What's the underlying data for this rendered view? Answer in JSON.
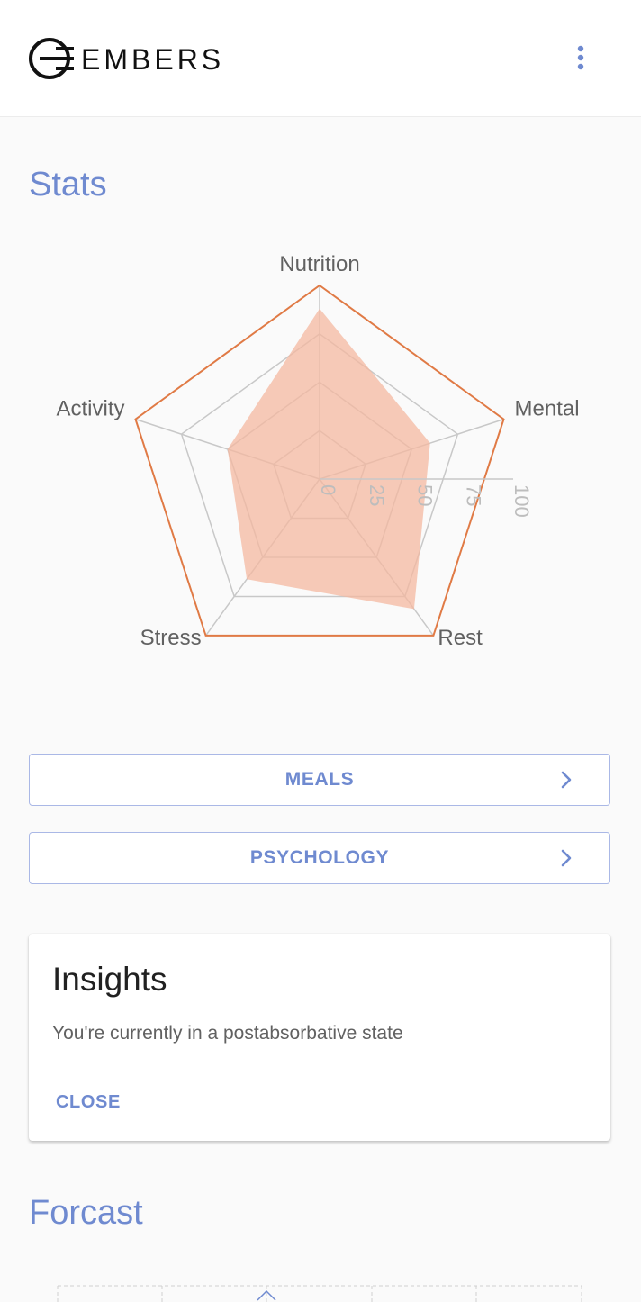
{
  "header": {
    "brand": "EMBERS",
    "menu_icon": "more-vert-icon"
  },
  "stats": {
    "title": "Stats",
    "chart_data": {
      "type": "radar",
      "axes": [
        "Nutrition",
        "Mental",
        "Rest",
        "Stress",
        "Activity"
      ],
      "ticks": [
        "0",
        "25",
        "50",
        "75",
        "100"
      ],
      "range": [
        0,
        100
      ],
      "values": [
        88,
        60,
        83,
        64,
        50
      ],
      "colors": {
        "fill": "#f4b8a0",
        "outline": "#e07a45",
        "grid": "#c8c8c8"
      }
    }
  },
  "buttons": {
    "meals_label": "MEALS",
    "psychology_label": "PSYCHOLOGY",
    "chevron_icon": "chevron-right-icon"
  },
  "insights": {
    "title": "Insights",
    "message": "You're currently in a postabsorbative state",
    "close_label": "CLOSE"
  },
  "forecast": {
    "title": "Forcast"
  },
  "theme": {
    "accent": "#6f8ad0",
    "background": "#fafafa"
  }
}
